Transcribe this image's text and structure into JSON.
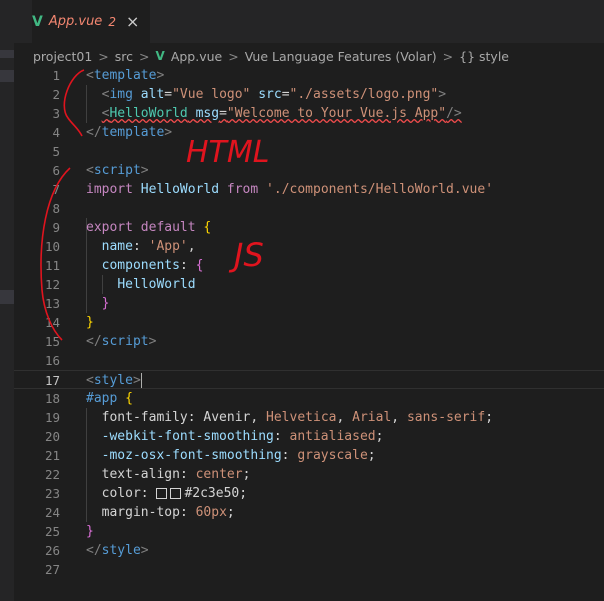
{
  "tab": {
    "filename": "App.vue",
    "problem_count": "2",
    "close_glyph": "×",
    "icon": "vue-icon"
  },
  "breadcrumb": {
    "items": [
      "project01",
      "src",
      "App.vue",
      "Vue Language Features (Volar)",
      "{} style"
    ],
    "separator": ">"
  },
  "editor": {
    "current_line": 17,
    "line_numbers": [
      "1",
      "2",
      "3",
      "4",
      "5",
      "6",
      "7",
      "8",
      "9",
      "10",
      "11",
      "12",
      "13",
      "14",
      "15",
      "16",
      "17",
      "18",
      "19",
      "20",
      "21",
      "22",
      "23",
      "24",
      "25",
      "26",
      "27"
    ]
  },
  "code": {
    "l1": {
      "open": "<",
      "tag": "template",
      "close": ">"
    },
    "l2": {
      "open": "<",
      "tag": "img",
      "a1": "alt",
      "eq": "=",
      "v1": "\"Vue logo\"",
      "a2": "src",
      "v2": "\"./assets/logo.png\"",
      "close": ">"
    },
    "l3": {
      "open": "<",
      "tag": "HelloWorld",
      "a1": "msg",
      "eq": "=",
      "v1": "\"Welcome to Your Vue.js App\"",
      "close": "/>"
    },
    "l4": {
      "open": "</",
      "tag": "template",
      "close": ">"
    },
    "l6": {
      "open": "<",
      "tag": "script",
      "close": ">"
    },
    "l7": {
      "kw1": "import",
      "name": "HelloWorld",
      "kw2": "from",
      "path": "'./components/HelloWorld.vue'"
    },
    "l9": {
      "kw1": "export",
      "kw2": "default",
      "brace": "{"
    },
    "l10": {
      "key": "name",
      "colon": ":",
      "val": "'App'",
      "comma": ","
    },
    "l11": {
      "key": "components",
      "colon": ":",
      "brace": "{"
    },
    "l12": {
      "name": "HelloWorld"
    },
    "l13": {
      "brace": "}"
    },
    "l14": {
      "brace": "}"
    },
    "l15": {
      "open": "</",
      "tag": "script",
      "close": ">"
    },
    "l17": {
      "open": "<",
      "tag": "style",
      "close": ">"
    },
    "l18": {
      "sel": "#app",
      "brace": "{"
    },
    "l19": {
      "prop": "font-family",
      "colon": ":",
      "v1": "Avenir",
      "v2": "Helvetica",
      "v3": "Arial",
      "v4": "sans-serif",
      "semi": ";"
    },
    "l20": {
      "prop": "-webkit-font-smoothing",
      "colon": ":",
      "val": "antialiased",
      "semi": ";"
    },
    "l21": {
      "prop": "-moz-osx-font-smoothing",
      "colon": ":",
      "val": "grayscale",
      "semi": ";"
    },
    "l22": {
      "prop": "text-align",
      "colon": ":",
      "val": "center",
      "semi": ";"
    },
    "l23": {
      "prop": "color",
      "colon": ":",
      "val": "#2c3e50",
      "semi": ";"
    },
    "l24": {
      "prop": "margin-top",
      "colon": ":",
      "val": "60px",
      "semi": ";"
    },
    "l25": {
      "brace": "}"
    },
    "l26": {
      "open": "</",
      "tag": "style",
      "close": ">"
    }
  },
  "annotations": {
    "html_label": "HTML",
    "js_label": "JS",
    "ink_color": "#e0141e"
  },
  "colors": {
    "vue_green": "#41b883",
    "error_red": "#f48771",
    "background": "#1e1e1e"
  }
}
